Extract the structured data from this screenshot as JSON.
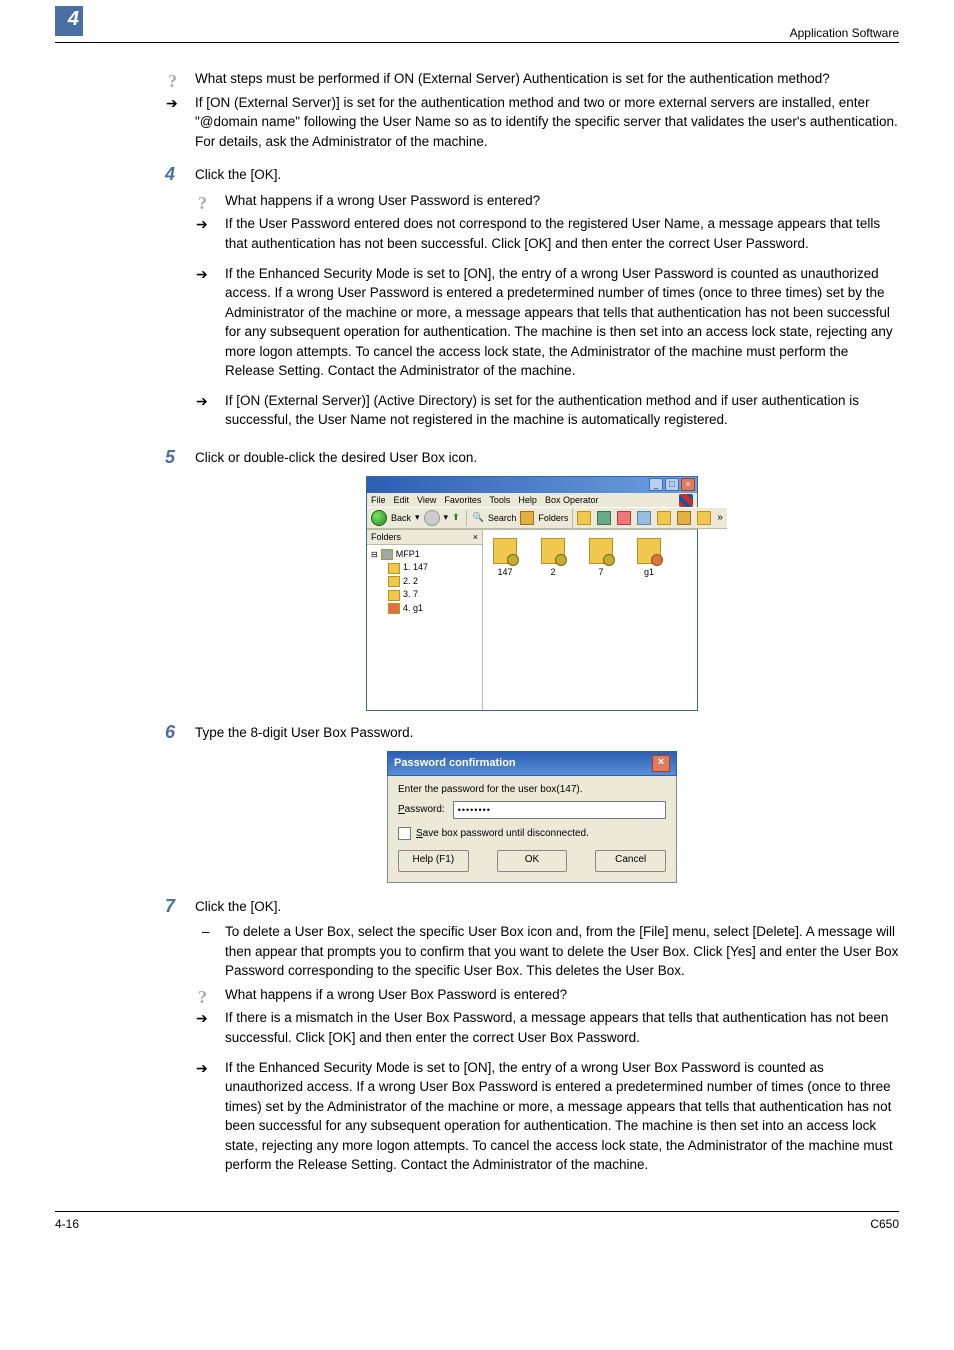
{
  "header": {
    "chapter_num": "4",
    "title": "Application Software"
  },
  "pre_q": "What steps must be performed if ON (External Server) Authentication is set for the authentication method?",
  "pre_a": "If [ON (External Server)] is set for the authentication method and two or more external servers are installed, enter \"@domain name\" following the User Name so as to identify the specific server that validates the user's authentication. For details, ask the Administrator of the machine.",
  "step4": {
    "num": "4",
    "text": "Click the [OK].",
    "q": "What happens if a wrong User Password is entered?",
    "a1": "If the User Password entered does not correspond to the registered User Name, a message appears that tells that authentication has not been successful. Click [OK] and then enter the correct User Password.",
    "a2": "If the Enhanced Security Mode is set to [ON], the entry of a wrong User Password is counted as unauthorized access. If a wrong User Password is entered a predetermined number of times (once to three times) set by the Administrator of the machine or more, a message appears that tells that authentication has not been successful for any subsequent operation for authentication. The machine is then set into an access lock state, rejecting any more logon attempts. To cancel the access lock state, the Administrator of the machine must perform the Release Setting. Contact the Administrator of the machine.",
    "a3": "If [ON (External Server)] (Active Directory) is set for the authentication method and if user authentication is successful, the User Name not registered in the machine is automatically registered."
  },
  "step5": {
    "num": "5",
    "text": "Click or double-click the desired User Box icon."
  },
  "explorer": {
    "menus": [
      "File",
      "Edit",
      "View",
      "Favorites",
      "Tools",
      "Help",
      "Box Operator"
    ],
    "toolbar_back": "Back",
    "toolbar_search": "Search",
    "toolbar_folders": "Folders",
    "tree_header": "Folders",
    "tree_close": "×",
    "tree_root": "MFP1",
    "tree_children": [
      "1. 147",
      "2. 2",
      "3. 7",
      "4. g1"
    ],
    "files": [
      "147",
      "2",
      "7",
      "g1"
    ]
  },
  "step6": {
    "num": "6",
    "text": "Type the 8-digit User Box Password."
  },
  "dialog": {
    "title": "Password confirmation",
    "prompt": "Enter the password for the user box(147).",
    "pw_label": "Password:",
    "pw_val": "••••••••",
    "save_label": "Save box password until disconnected.",
    "help": "Help (F1)",
    "ok": "OK",
    "cancel": "Cancel"
  },
  "step7": {
    "num": "7",
    "text": "Click the [OK].",
    "d1": "To delete a User Box, select the specific User Box icon and, from the [File] menu, select [Delete]. A message will then appear that prompts you to confirm that you want to delete the User Box. Click [Yes] and enter the User Box Password corresponding to the specific User Box. This deletes the User Box.",
    "q": "What happens if a wrong User Box Password is entered?",
    "a1": "If there is a mismatch in the User Box Password, a message appears that tells that authentication has not been successful. Click [OK] and then enter the correct User Box Password.",
    "a2": "If the Enhanced Security Mode is set to [ON], the entry of a wrong User Box Password is counted as unauthorized access. If a wrong User Box Password is entered a predetermined number of times (once to three times) set by the Administrator of the machine or more, a message appears that tells that authentication has not been successful for any subsequent operation for authentication. The machine is then set into an access lock state, rejecting any more logon attempts. To cancel the access lock state, the Administrator of the machine must perform the Release Setting. Contact the Administrator of the machine."
  },
  "footer": {
    "pg": "4-16",
    "model": "C650"
  }
}
